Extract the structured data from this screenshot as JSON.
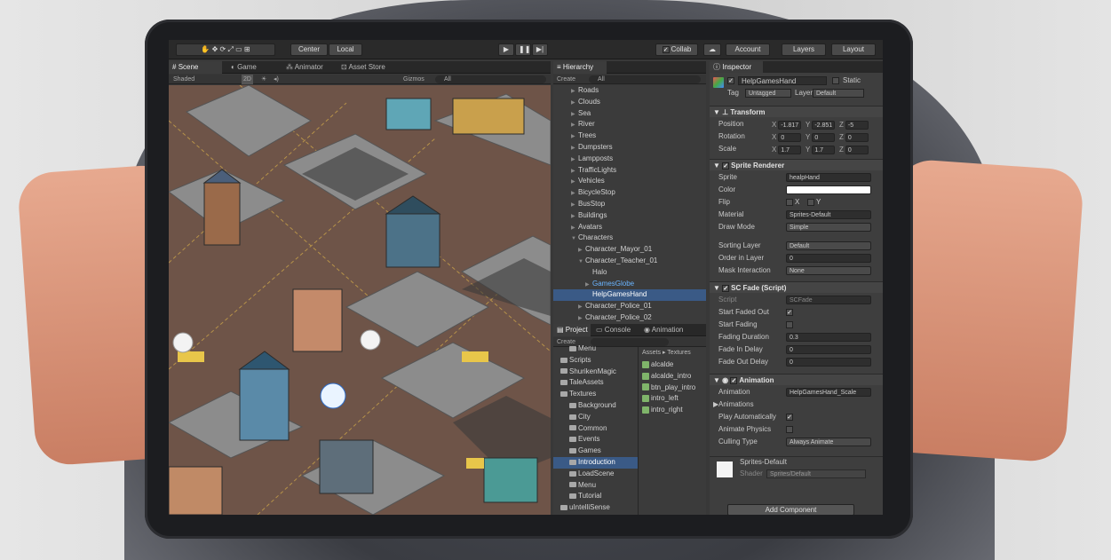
{
  "toolbar": {
    "pivot_center": "Center",
    "pivot_local": "Local",
    "collab": "Collab",
    "account": "Account",
    "layers": "Layers",
    "layout": "Layout"
  },
  "scene_tabs": [
    "Scene",
    "Game",
    "Animator",
    "Asset Store"
  ],
  "scene_bar": {
    "shading": "Shaded",
    "mode_2d": "2D",
    "gizmos": "Gizmos",
    "search_placeholder": "All"
  },
  "hierarchy": {
    "tab": "Hierarchy",
    "create": "Create",
    "search_placeholder": "All",
    "items": [
      {
        "label": "Roads",
        "indent": 0,
        "arrow": "▶"
      },
      {
        "label": "Clouds",
        "indent": 0,
        "arrow": "▶"
      },
      {
        "label": "Sea",
        "indent": 0,
        "arrow": "▶"
      },
      {
        "label": "River",
        "indent": 0,
        "arrow": "▶"
      },
      {
        "label": "Trees",
        "indent": 0,
        "arrow": "▶"
      },
      {
        "label": "Dumpsters",
        "indent": 0,
        "arrow": "▶"
      },
      {
        "label": "Lampposts",
        "indent": 0,
        "arrow": "▶"
      },
      {
        "label": "TrafficLights",
        "indent": 0,
        "arrow": "▶"
      },
      {
        "label": "Vehicles",
        "indent": 0,
        "arrow": "▶"
      },
      {
        "label": "BicycleStop",
        "indent": 0,
        "arrow": "▶"
      },
      {
        "label": "BusStop",
        "indent": 0,
        "arrow": "▶"
      },
      {
        "label": "Buildings",
        "indent": 0,
        "arrow": "▶"
      },
      {
        "label": "Avatars",
        "indent": 0,
        "arrow": "▶"
      },
      {
        "label": "Characters",
        "indent": 0,
        "arrow": "▼"
      },
      {
        "label": "Character_Mayor_01",
        "indent": 1,
        "arrow": "▶"
      },
      {
        "label": "Character_Teacher_01",
        "indent": 1,
        "arrow": "▼"
      },
      {
        "label": "Halo",
        "indent": 2,
        "arrow": ""
      },
      {
        "label": "GamesGlobe",
        "indent": 2,
        "arrow": "▶",
        "style": "blue"
      },
      {
        "label": "HelpGamesHand",
        "indent": 2,
        "arrow": "",
        "style": "sel"
      },
      {
        "label": "Character_Police_01",
        "indent": 1,
        "arrow": "▶"
      },
      {
        "label": "Character_Police_02",
        "indent": 1,
        "arrow": "▶"
      }
    ]
  },
  "project": {
    "tabs": [
      "Project",
      "Console",
      "Animation"
    ],
    "create": "Create",
    "breadcrumb_assets": "Assets",
    "breadcrumb_textures": "Textures",
    "tree": [
      {
        "label": "Menu",
        "indent": 1
      },
      {
        "label": "Scripts",
        "indent": 0
      },
      {
        "label": "ShurikenMagic",
        "indent": 0
      },
      {
        "label": "TaleAssets",
        "indent": 0
      },
      {
        "label": "Textures",
        "indent": 0
      },
      {
        "label": "Background",
        "indent": 1
      },
      {
        "label": "City",
        "indent": 1
      },
      {
        "label": "Common",
        "indent": 1
      },
      {
        "label": "Events",
        "indent": 1
      },
      {
        "label": "Games",
        "indent": 1
      },
      {
        "label": "Introduction",
        "indent": 1,
        "sel": true
      },
      {
        "label": "LoadScene",
        "indent": 1
      },
      {
        "label": "Menu",
        "indent": 1
      },
      {
        "label": "Tutorial",
        "indent": 1
      },
      {
        "label": "uIntelliSense",
        "indent": 0
      }
    ],
    "files": [
      "alcalde",
      "alcalde_intro",
      "btn_play_intro",
      "intro_left",
      "intro_right"
    ]
  },
  "inspector": {
    "tab": "Inspector",
    "object_name": "HelpGamesHand",
    "static": "Static",
    "tag_label": "Tag",
    "tag_value": "Untagged",
    "layer_label": "Layer",
    "layer_value": "Default",
    "transform": {
      "title": "Transform",
      "position_label": "Position",
      "rotation_label": "Rotation",
      "scale_label": "Scale",
      "position": [
        "-1.817",
        "-2.851",
        "-5"
      ],
      "rotation": [
        "0",
        "0",
        "0"
      ],
      "scale": [
        "1.7",
        "1.7",
        "0"
      ]
    },
    "sprite_renderer": {
      "title": "Sprite Renderer",
      "sprite_label": "Sprite",
      "sprite": "healpHand",
      "color_label": "Color",
      "flip_label": "Flip",
      "flip_x": "X",
      "flip_y": "Y",
      "material_label": "Material",
      "material": "Sprites-Default",
      "draw_mode_label": "Draw Mode",
      "draw_mode": "Simple",
      "sorting_layer_label": "Sorting Layer",
      "sorting_layer": "Default",
      "order_label": "Order in Layer",
      "order": "0",
      "mask_label": "Mask Interaction",
      "mask": "None"
    },
    "sc_fade": {
      "title": "SC Fade (Script)",
      "script_label": "Script",
      "script": "SCFade",
      "start_faded_out_label": "Start Faded Out",
      "start_fading_label": "Start Fading",
      "fading_duration_label": "Fading Duration",
      "fading_duration": "0.3",
      "fade_in_delay_label": "Fade In Delay",
      "fade_in_delay": "0",
      "fade_out_delay_label": "Fade Out Delay",
      "fade_out_delay": "0"
    },
    "animation": {
      "title": "Animation",
      "animation_label": "Animation",
      "animation": "HelpGamesHand_Scale",
      "animations_label": "Animations",
      "play_auto_label": "Play Automatically",
      "animate_physics_label": "Animate Physics",
      "culling_label": "Culling Type",
      "culling": "Always Animate"
    },
    "material": {
      "name": "Sprites-Default",
      "shader_label": "Shader",
      "shader": "Sprites/Default"
    },
    "add_component": "Add Component"
  }
}
